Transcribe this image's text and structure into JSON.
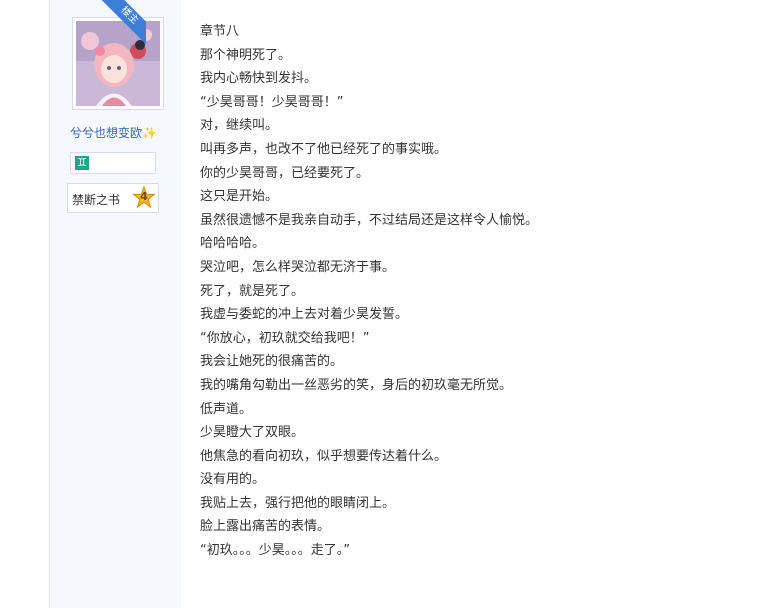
{
  "post": {
    "op_badge": "楼主",
    "username": "兮兮也想变欧",
    "username_suffix": "✨",
    "zodiac_glyph": "♊",
    "level": {
      "title": "禁断之书",
      "number": "4"
    }
  },
  "content": {
    "lines": [
      "章节八",
      "那个神明死了。",
      "我内心畅快到发抖。",
      "“少昊哥哥！少昊哥哥！”",
      "对，继续叫。",
      "叫再多声，也改不了他已经死了的事实哦。",
      "你的少昊哥哥，已经要死了。",
      "这只是开始。",
      "虽然很遗憾不是我亲自动手，不过结局还是这样令人愉悦。",
      "哈哈哈哈。",
      "哭泣吧，怎么样哭泣都无济于事。",
      "死了，就是死了。",
      "我虚与委蛇的冲上去对着少昊发誓。",
      "“你放心，初玖就交给我吧！”",
      "我会让她死的很痛苦的。",
      "我的嘴角勾勒出一丝恶劣的笑，身后的初玖毫无所觉。",
      "低声道。",
      "少昊瞪大了双眼。",
      "他焦急的看向初玖，似乎想要传达着什么。",
      "没有用的。",
      "我贴上去，强行把他的眼睛闭上。",
      "脸上露出痛苦的表情。",
      "“初玖。。。少昊。。。走了。”"
    ]
  }
}
